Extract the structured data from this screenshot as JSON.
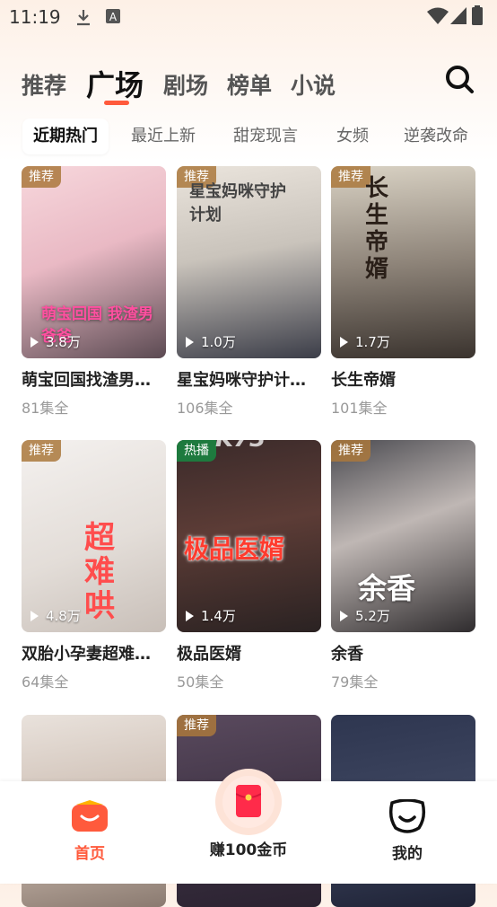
{
  "status_bar": {
    "time": "11:19"
  },
  "header": {
    "tabs": [
      "推荐",
      "广场",
      "剧场",
      "榜单",
      "小说"
    ],
    "active_tab": "广场"
  },
  "chips": [
    "近期热门",
    "最近上新",
    "甜宠现言",
    "女频",
    "逆袭改命"
  ],
  "watermark": "K73",
  "cards": [
    {
      "badge": "推荐",
      "plays": "3.8万",
      "title": "萌宝回国找渣男…",
      "episodes": "81集全",
      "poster_text": "萌宝回国 我渣男爸爸"
    },
    {
      "badge": "推荐",
      "plays": "1.0万",
      "title": "星宝妈咪守护计…",
      "episodes": "106集全",
      "poster_text": "星宝妈咪守护计划"
    },
    {
      "badge": "推荐",
      "plays": "1.7万",
      "title": "长生帝婿",
      "episodes": "101集全",
      "poster_text": "长生帝婿"
    },
    {
      "badge": "推荐",
      "plays": "4.8万",
      "title": "双胎小孕妻超难…",
      "episodes": "64集全",
      "poster_text": "超难哄"
    },
    {
      "badge": "热播",
      "plays": "1.4万",
      "title": "极品医婿",
      "episodes": "50集全",
      "poster_text": "极品医婿"
    },
    {
      "badge": "推荐",
      "plays": "5.2万",
      "title": "余香",
      "episodes": "79集全",
      "poster_text": "余香"
    },
    {
      "badge": "",
      "plays": "",
      "title": "",
      "episodes": "",
      "poster_text": ""
    },
    {
      "badge": "推荐",
      "plays": "",
      "title": "",
      "episodes": "",
      "poster_text": ""
    },
    {
      "badge": "",
      "plays": "",
      "title": "",
      "episodes": "",
      "poster_text": ""
    }
  ],
  "bottom_nav": {
    "home": "首页",
    "earn": "赚100金币",
    "mine": "我的"
  },
  "colors": {
    "accent": "#ff5a3c",
    "recommend_badge": "#aa783c",
    "hot_badge": "#1e7a3e"
  },
  "icons": [
    "download-icon",
    "a-badge-icon",
    "wifi-icon",
    "signal-icon",
    "battery-icon",
    "search-icon",
    "home-tv-icon",
    "red-envelope-icon",
    "smile-face-icon",
    "play-icon"
  ]
}
